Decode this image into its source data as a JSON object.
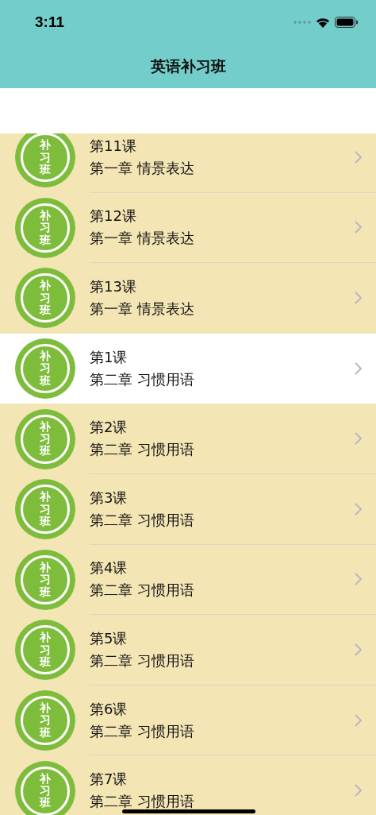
{
  "status_bar": {
    "time": "3:11"
  },
  "nav_bar": {
    "title": "英语补习班"
  },
  "lessons": [
    {
      "logo_text": "补习班",
      "title": "第11课",
      "subtitle": "第一章 情景表达",
      "selected": false
    },
    {
      "logo_text": "补习班",
      "title": "第12课",
      "subtitle": "第一章 情景表达",
      "selected": false
    },
    {
      "logo_text": "补习班",
      "title": "第13课",
      "subtitle": "第一章 情景表达",
      "selected": false
    },
    {
      "logo_text": "补习班",
      "title": "第1课",
      "subtitle": "第二章 习惯用语",
      "selected": true
    },
    {
      "logo_text": "补习班",
      "title": "第2课",
      "subtitle": "第二章 习惯用语",
      "selected": false
    },
    {
      "logo_text": "补习班",
      "title": "第3课",
      "subtitle": "第二章 习惯用语",
      "selected": false
    },
    {
      "logo_text": "补习班",
      "title": "第4课",
      "subtitle": "第二章 习惯用语",
      "selected": false
    },
    {
      "logo_text": "补习班",
      "title": "第5课",
      "subtitle": "第二章 习惯用语",
      "selected": false
    },
    {
      "logo_text": "补习班",
      "title": "第6课",
      "subtitle": "第二章 习惯用语",
      "selected": false
    },
    {
      "logo_text": "补习班",
      "title": "第7课",
      "subtitle": "第二章 习惯用语",
      "selected": false
    }
  ]
}
